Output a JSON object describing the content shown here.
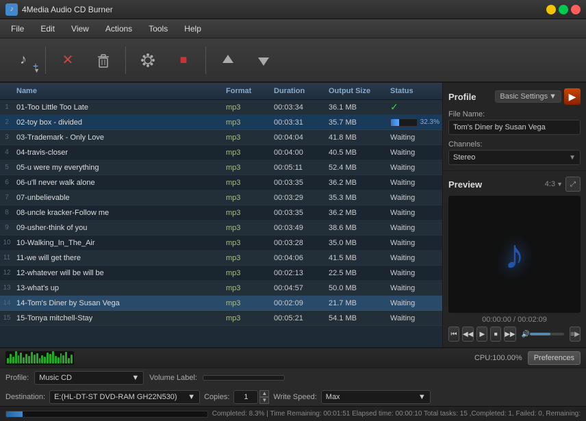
{
  "app": {
    "title": "4Media Audio CD Burner",
    "icon": "♪"
  },
  "titlebar": {
    "title": "4Media Audio CD Burner"
  },
  "menubar": {
    "items": [
      "File",
      "Edit",
      "View",
      "Actions",
      "Tools",
      "Help"
    ]
  },
  "toolbar": {
    "buttons": [
      {
        "name": "add-music",
        "icon": "♪+",
        "has_arrow": true
      },
      {
        "name": "remove",
        "icon": "✕"
      },
      {
        "name": "delete",
        "icon": "🗑"
      },
      {
        "name": "settings",
        "icon": "⚙"
      },
      {
        "name": "stop",
        "icon": "■"
      },
      {
        "name": "move-up",
        "icon": "↑"
      },
      {
        "name": "move-down",
        "icon": "↓"
      }
    ]
  },
  "filelist": {
    "headers": [
      "",
      "Name",
      "Format",
      "Duration",
      "Output Size",
      "Status"
    ],
    "rows": [
      {
        "num": "1",
        "name": "01-Too Little Too Late",
        "format": "mp3",
        "duration": "00:03:34",
        "size": "36.1 MB",
        "status": "ok",
        "progress": null,
        "pct": null
      },
      {
        "num": "2",
        "name": "02-toy box - divided",
        "format": "mp3",
        "duration": "00:03:31",
        "size": "35.7 MB",
        "status": "progress",
        "progress": 32,
        "pct": "32.3%"
      },
      {
        "num": "3",
        "name": "03-Trademark - Only Love",
        "format": "mp3",
        "duration": "00:04:04",
        "size": "41.8 MB",
        "status": "waiting",
        "progress": null,
        "pct": null
      },
      {
        "num": "4",
        "name": "04-travis-closer",
        "format": "mp3",
        "duration": "00:04:00",
        "size": "40.5 MB",
        "status": "waiting",
        "progress": null,
        "pct": null
      },
      {
        "num": "5",
        "name": "05-u were my everything",
        "format": "mp3",
        "duration": "00:05:11",
        "size": "52.4 MB",
        "status": "waiting",
        "progress": null,
        "pct": null
      },
      {
        "num": "6",
        "name": "06-u'll never walk alone",
        "format": "mp3",
        "duration": "00:03:35",
        "size": "36.2 MB",
        "status": "waiting",
        "progress": null,
        "pct": null
      },
      {
        "num": "7",
        "name": "07-unbelievable",
        "format": "mp3",
        "duration": "00:03:29",
        "size": "35.3 MB",
        "status": "waiting",
        "progress": null,
        "pct": null
      },
      {
        "num": "8",
        "name": "08-uncle kracker-Follow me",
        "format": "mp3",
        "duration": "00:03:35",
        "size": "36.2 MB",
        "status": "waiting",
        "progress": null,
        "pct": null
      },
      {
        "num": "9",
        "name": "09-usher-think of you",
        "format": "mp3",
        "duration": "00:03:49",
        "size": "38.6 MB",
        "status": "waiting",
        "progress": null,
        "pct": null
      },
      {
        "num": "10",
        "name": "10-Walking_In_The_Air",
        "format": "mp3",
        "duration": "00:03:28",
        "size": "35.0 MB",
        "status": "waiting",
        "progress": null,
        "pct": null
      },
      {
        "num": "11",
        "name": "11-we will get there",
        "format": "mp3",
        "duration": "00:04:06",
        "size": "41.5 MB",
        "status": "waiting",
        "progress": null,
        "pct": null
      },
      {
        "num": "12",
        "name": "12-whatever will be will be",
        "format": "mp3",
        "duration": "00:02:13",
        "size": "22.5 MB",
        "status": "waiting",
        "progress": null,
        "pct": null
      },
      {
        "num": "13",
        "name": "13-what's up",
        "format": "mp3",
        "duration": "00:04:57",
        "size": "50.0 MB",
        "status": "waiting",
        "progress": null,
        "pct": null
      },
      {
        "num": "14",
        "name": "14-Tom's Diner by Susan Vega",
        "format": "mp3",
        "duration": "00:02:09",
        "size": "21.7 MB",
        "status": "waiting",
        "selected": true,
        "progress": null,
        "pct": null
      },
      {
        "num": "15",
        "name": "15-Tonya mitchell-Stay",
        "format": "mp3",
        "duration": "00:05:21",
        "size": "54.1 MB",
        "status": "waiting",
        "progress": null,
        "pct": null
      }
    ]
  },
  "rightpanel": {
    "profile_title": "Profile",
    "basic_settings_label": "Basic Settings",
    "arrow_btn": "▶",
    "filename_label": "File Name:",
    "filename_value": "Tom's Diner by Susan Vega",
    "channels_label": "Channels:",
    "channels_value": "Stereo",
    "preview_title": "Preview",
    "preview_ratio": "4:3",
    "preview_time": "00:00:00 / 00:02:09",
    "controls": [
      "⏮",
      "◀◀",
      "▶",
      "⏹",
      "▶▶"
    ]
  },
  "statusbar": {
    "cpu_label": "CPU:100.00%",
    "preferences_label": "Preferences"
  },
  "optionsbar": {
    "profile_label": "Profile:",
    "profile_value": "Music CD",
    "volume_label": "Volume Label:",
    "destination_label": "Destination:",
    "destination_value": "E:(HL-DT-ST DVD-RAM GH22N530)",
    "copies_label": "Copies:",
    "copies_value": "1",
    "write_speed_label": "Write Speed:",
    "write_speed_value": "Max"
  },
  "bottombar": {
    "status_text": "Completed: 8.3% | Time Remaining: 00:01:51 Elapsed time: 00:00:10 Total tasks: 15 ,Completed: 1, Failed: 0, Remaining:",
    "progress_pct": 8.3
  },
  "waveform_bars": [
    8,
    14,
    10,
    18,
    12,
    16,
    9,
    14,
    11,
    17,
    13,
    15,
    8,
    12,
    10,
    16,
    14,
    18,
    11,
    9,
    15,
    12,
    17,
    8,
    13
  ],
  "colors": {
    "accent": "#3377cc",
    "bg_dark": "#1e2a35",
    "selected_row": "#2a4a6a",
    "ok_color": "#44cc44",
    "waveform": "#22aa22"
  }
}
